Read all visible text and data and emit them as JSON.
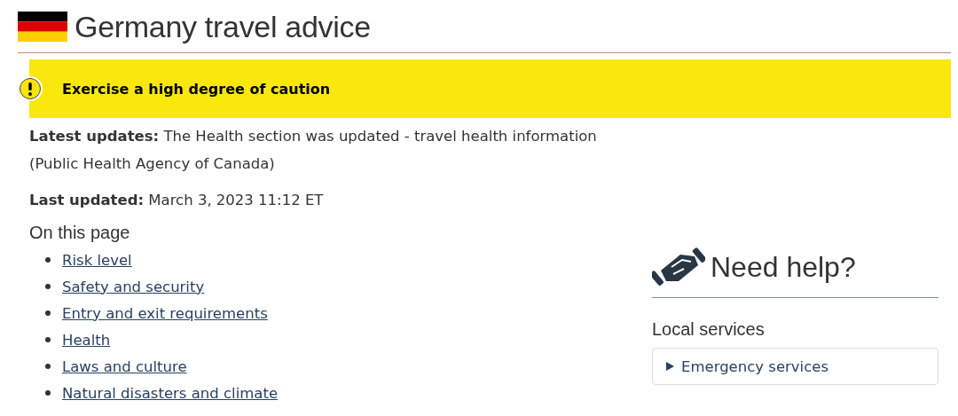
{
  "page": {
    "title": "Germany travel advice"
  },
  "risk_banner": {
    "text": "Exercise a high degree of caution"
  },
  "latest_updates": {
    "label": "Latest updates:",
    "text": "The Health section was updated - travel health information (Public Health Agency of Canada)"
  },
  "last_updated": {
    "label": "Last updated:",
    "text": "March 3, 2023 11:12 ET"
  },
  "on_this_page": {
    "heading": "On this page",
    "links": [
      "Risk level",
      "Safety and security",
      "Entry and exit requirements",
      "Health",
      "Laws and culture",
      "Natural disasters and climate"
    ]
  },
  "need_help": {
    "heading": "Need help?",
    "section": "Local services",
    "accordions": [
      {
        "label": "Emergency services",
        "expanded": false
      }
    ]
  }
}
